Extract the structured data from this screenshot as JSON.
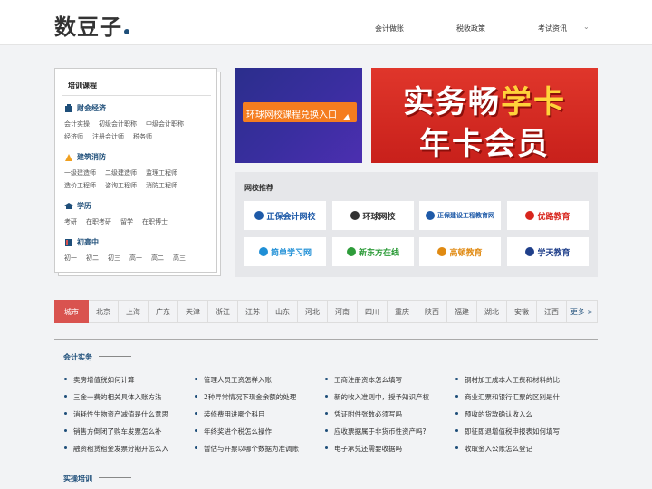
{
  "header": {
    "logo": "数豆子",
    "nav": [
      "会计做账",
      "税收政策",
      "考试资讯"
    ],
    "nav_dropdown": "⌄"
  },
  "courses": {
    "title": "培训课程",
    "categories": [
      {
        "name": "财会经济",
        "icon": "finance-icon",
        "links": [
          "会计实操",
          "初级会计职称",
          "中级会计职称",
          "经济师",
          "注册会计师",
          "税务师"
        ]
      },
      {
        "name": "建筑消防",
        "icon": "construction-icon",
        "links": [
          "一级建造师",
          "二级建造师",
          "监理工程师",
          "造价工程师",
          "咨询工程师",
          "消防工程师"
        ]
      },
      {
        "name": "学历",
        "icon": "graduation-icon",
        "links": [
          "考研",
          "在职考研",
          "留学",
          "在职博士"
        ]
      },
      {
        "name": "初高中",
        "icon": "book-icon",
        "links": [
          "初一",
          "初二",
          "初三",
          "高一",
          "高二",
          "高三"
        ]
      }
    ]
  },
  "banners": {
    "left_text": "环球网校课程兑换入口",
    "right_line1_a": "实务畅",
    "right_line1_b": "学卡",
    "right_line2": "年卡会员"
  },
  "schools": {
    "title": "网校推荐",
    "items": [
      {
        "name": "正保会计网校",
        "color": "#1e5aa8",
        "icon": "zhengbao-icon"
      },
      {
        "name": "环球网校",
        "color": "#333333",
        "icon": "globe-icon"
      },
      {
        "name": "正保建设工程教育网",
        "color": "#1e5aa8",
        "icon": "zhengbao-icon"
      },
      {
        "name": "优路教育",
        "color": "#d8261d",
        "icon": "youlu-icon"
      },
      {
        "name": "简单学习网",
        "color": "#1f8fd6",
        "icon": "jd100-icon"
      },
      {
        "name": "新东方在线",
        "color": "#2e9c3a",
        "icon": "xdf-icon"
      },
      {
        "name": "高顿教育",
        "color": "#e08a12",
        "icon": "gaodun-icon"
      },
      {
        "name": "学天教育",
        "color": "#1f3f8a",
        "icon": "xuetian-icon"
      }
    ]
  },
  "cities": [
    "城市",
    "北京",
    "上海",
    "广东",
    "天津",
    "浙江",
    "江苏",
    "山东",
    "河北",
    "河南",
    "四川",
    "重庆",
    "陕西",
    "福建",
    "湖北",
    "安徽",
    "江西",
    "更多 >"
  ],
  "sections": {
    "accounting_title": "会计实务",
    "training_title": "实操培训"
  },
  "articles": [
    [
      "卖房增值税如何计算",
      "管理人员工资怎样入账",
      "工商注册资本怎么填写",
      "钢材加工成本人工费和材料的比"
    ],
    [
      "三金一费的相关具体入账方法",
      "2种异常情况下现金余额的处理",
      "新的收入准则中，授予知识产权",
      "商业汇票和银行汇票的区别是什"
    ],
    [
      "消耗性生物资产减值是什么意思",
      "装修费用进哪个科目",
      "凭证附件张数必须写吗",
      "预收的货款确认收入么"
    ],
    [
      "销售方倒闭了购车发票怎么补",
      "年终奖进个税怎么操作",
      "应收票据属于非货币性资产吗?",
      "即征即退增值税申报表如何填写"
    ],
    [
      "融资租赁租金发票分期开怎么入",
      "暂估与开票以哪个数据为准调账",
      "电子承兑还需要收据吗",
      "收取金入公账怎么登记"
    ]
  ]
}
